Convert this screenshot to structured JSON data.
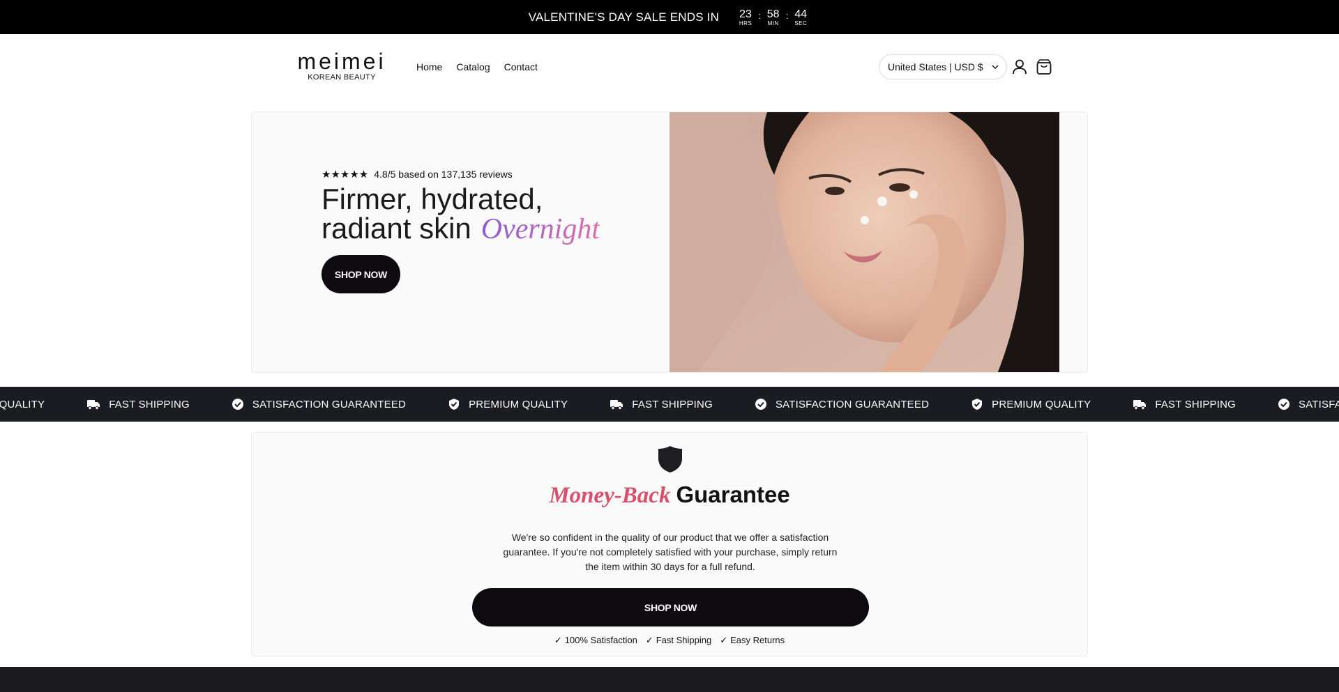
{
  "announcement": {
    "message": "VALENTINE'S DAY SALE ENDS IN",
    "timer": [
      {
        "value": "23",
        "label": "HRS"
      },
      {
        "value": "58",
        "label": "MIN"
      },
      {
        "value": "44",
        "label": "SEC"
      }
    ],
    "separator": ":"
  },
  "header": {
    "logo_name": "meimei",
    "logo_sub": "KOREAN BEAUTY",
    "nav": [
      "Home",
      "Catalog",
      "Contact"
    ],
    "locale": "United States | USD $",
    "icons": [
      "account-icon",
      "cart-icon"
    ]
  },
  "hero": {
    "stars": "★★★★★",
    "rating_text": "4.8/5 based on 137,135 reviews",
    "title_line1": "Firmer, hydrated,",
    "title_line2": "radiant skin",
    "title_accent": "Overnight",
    "button": "SHOP NOW"
  },
  "marquee": {
    "items": [
      {
        "icon": "badge-check-icon",
        "label": "PREMIUM QUALITY"
      },
      {
        "icon": "truck-icon",
        "label": "FAST SHIPPING"
      },
      {
        "icon": "check-circle-icon",
        "label": "SATISFACTION GUARANTEED"
      },
      {
        "icon": "badge-check-icon",
        "label": "PREMIUM QUALITY"
      },
      {
        "icon": "truck-icon",
        "label": "FAST SHIPPING"
      },
      {
        "icon": "check-circle-icon",
        "label": "SATISFACTION GUARANTEED"
      },
      {
        "icon": "badge-check-icon",
        "label": "PREMIUM QUALITY"
      },
      {
        "icon": "truck-icon",
        "label": "FAST SHIPPING"
      },
      {
        "icon": "check-circle-icon",
        "label": "SATISFACTION GUARANTEED"
      }
    ]
  },
  "guarantee": {
    "title_accent": "Money-Back",
    "title_rest": "Guarantee",
    "body": "We're so confident in the quality of our product that we offer a satisfaction guarantee. If you're not completely satisfied with your purchase, simply return the item within 30 days for a full refund.",
    "button": "SHOP NOW",
    "checks": [
      "100% Satisfaction",
      "Fast Shipping",
      "Easy Returns"
    ]
  },
  "colors": {
    "announcement_bg": "#000000",
    "marquee_bg": "#1b1b22",
    "button_bg": "#0d0b10",
    "accent_purple": "#8a5cd6",
    "accent_pink": "#d94f6c"
  }
}
